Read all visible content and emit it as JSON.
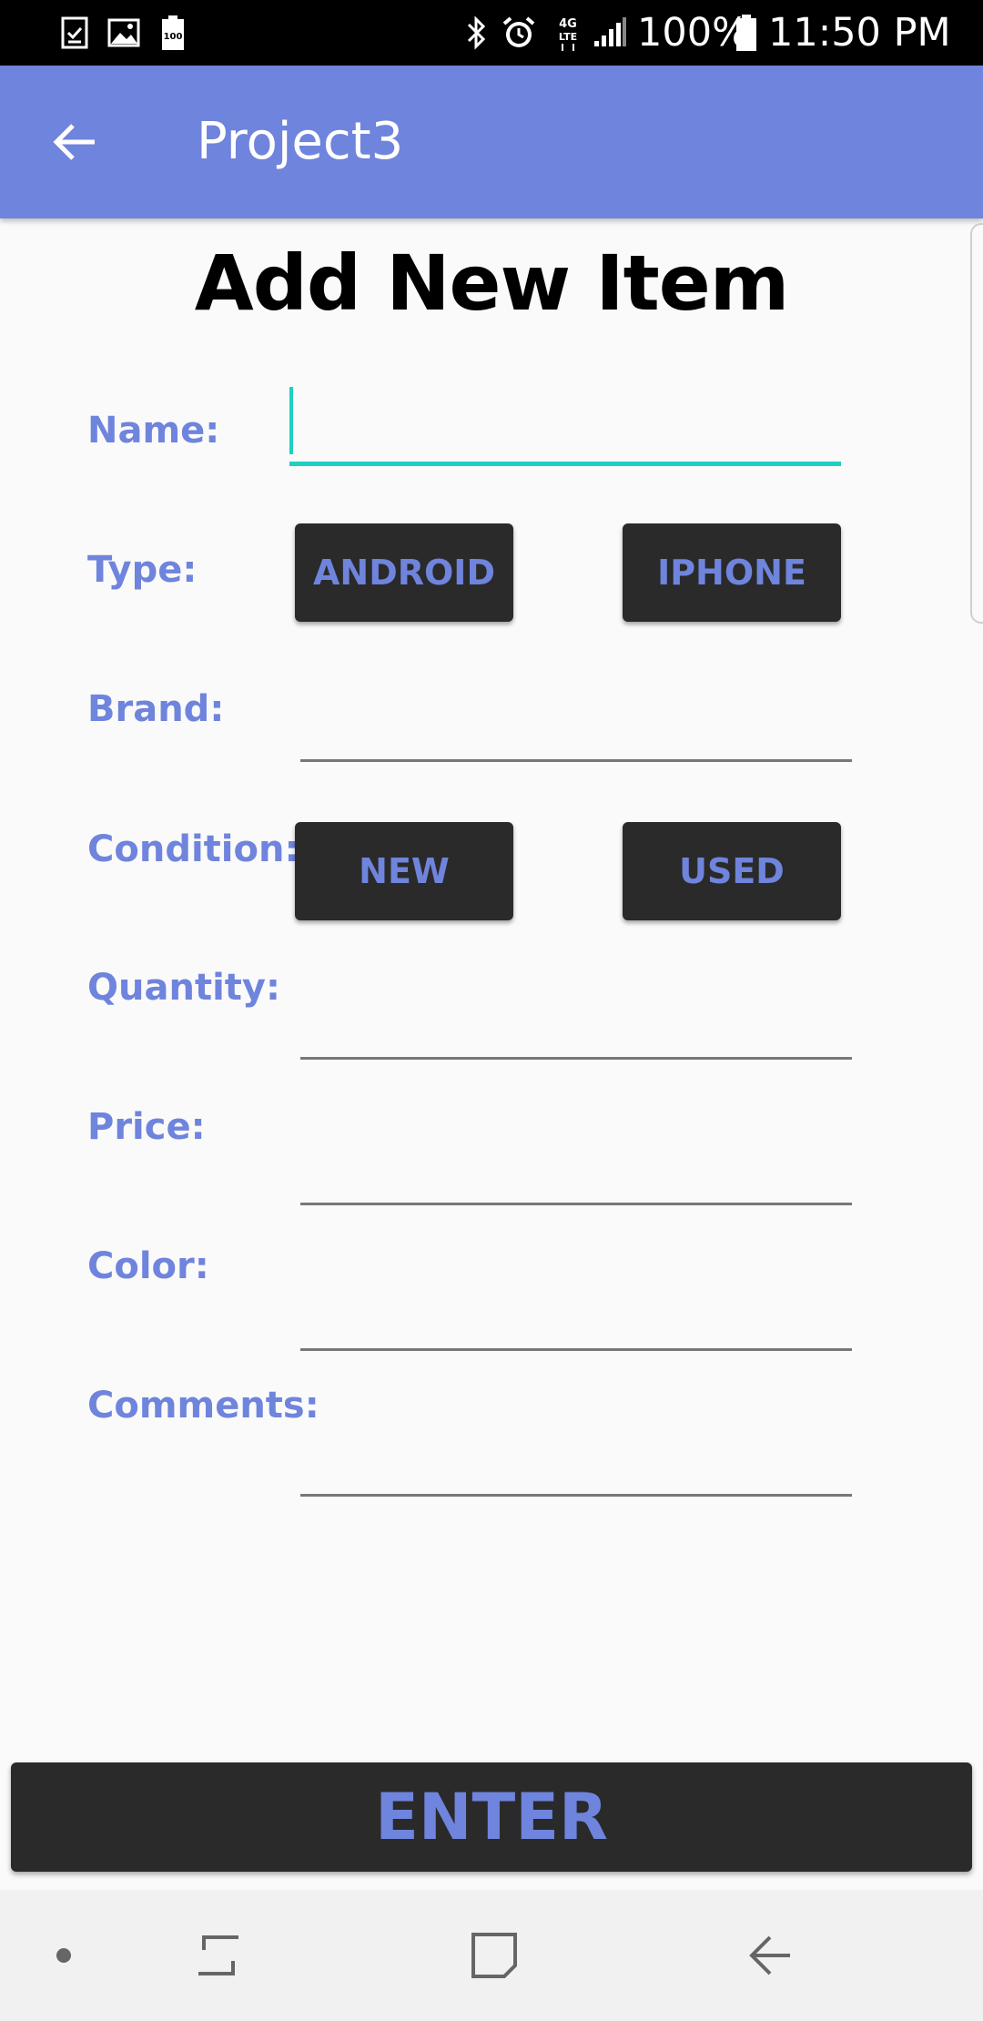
{
  "status_bar": {
    "battery_percent": "100%",
    "time": "11:50 PM",
    "icons": [
      "task-icon",
      "image-icon",
      "battery-100-icon",
      "bluetooth-icon",
      "alarm-icon",
      "lte-icon",
      "signal-icon",
      "battery-icon"
    ]
  },
  "app_bar": {
    "title": "Project3",
    "back_icon": "arrow-left-icon"
  },
  "form": {
    "title": "Add New Item",
    "labels": {
      "name": "Name:",
      "type": "Type:",
      "brand": "Brand:",
      "condition": "Condition:",
      "quantity": "Quantity:",
      "price": "Price:",
      "color": "Color:",
      "comments": "Comments:"
    },
    "type_buttons": {
      "android": "ANDROID",
      "iphone": "IPHONE"
    },
    "condition_buttons": {
      "new": "NEW",
      "used": "USED"
    },
    "name_value": "",
    "brand_value": "",
    "quantity_value": "",
    "price_value": "",
    "color_value": "",
    "comments_value": ""
  },
  "enter_label": "ENTER",
  "colors": {
    "accent": "#6f84dc",
    "focus": "#1fcfc1",
    "button_bg": "#2a2a2a"
  },
  "nav_bar": {
    "icons": [
      "dot-icon",
      "recents-icon",
      "home-icon",
      "back-icon"
    ]
  }
}
